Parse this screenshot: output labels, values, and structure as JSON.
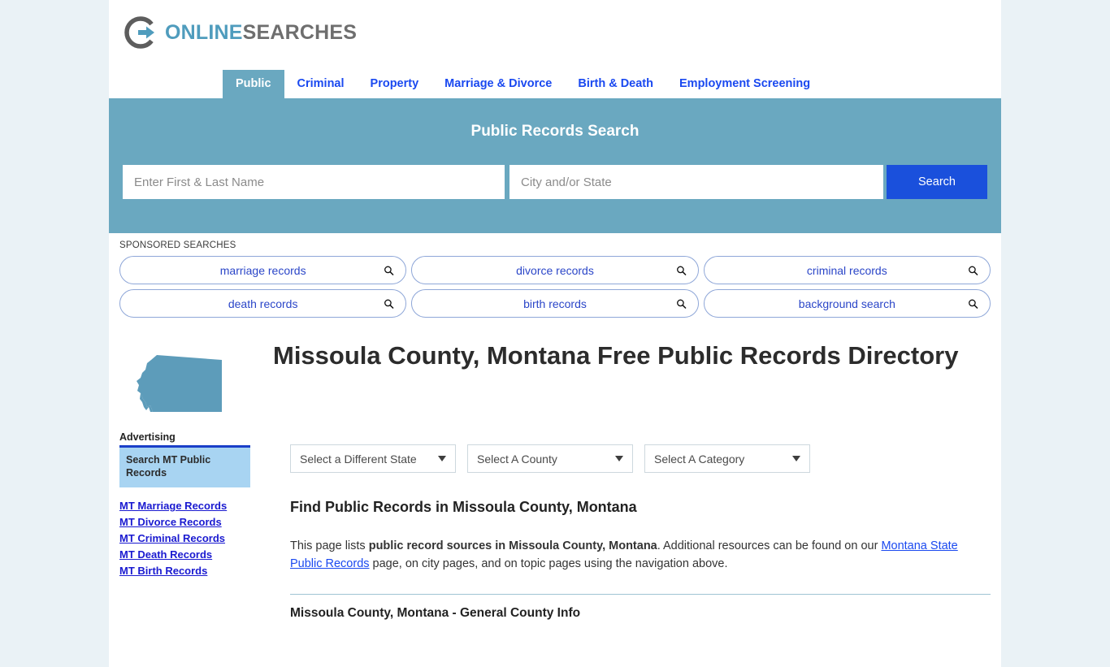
{
  "brand": {
    "name_part1": "ONLINE",
    "name_part2": "SEARCHES",
    "logo_icon": "circle-arrow-logo-icon",
    "accent_teal": "#6aa8c0",
    "accent_blue": "#1a50dc",
    "link_blue": "#1a49f0"
  },
  "nav": {
    "items": [
      {
        "label": "Public",
        "active": true
      },
      {
        "label": "Criminal",
        "active": false
      },
      {
        "label": "Property",
        "active": false
      },
      {
        "label": "Marriage & Divorce",
        "active": false
      },
      {
        "label": "Birth & Death",
        "active": false
      },
      {
        "label": "Employment Screening",
        "active": false
      }
    ]
  },
  "search_banner": {
    "title": "Public Records Search",
    "name_placeholder": "Enter First & Last Name",
    "name_value": "",
    "city_placeholder": "City and/or State",
    "city_value": "",
    "button_label": "Search"
  },
  "sponsored": {
    "label": "SPONSORED SEARCHES",
    "items": [
      {
        "label": "marriage records",
        "icon": "search-icon"
      },
      {
        "label": "divorce records",
        "icon": "search-icon"
      },
      {
        "label": "criminal records",
        "icon": "search-icon"
      },
      {
        "label": "death records",
        "icon": "search-icon"
      },
      {
        "label": "birth records",
        "icon": "search-icon"
      },
      {
        "label": "background search",
        "icon": "search-icon"
      }
    ]
  },
  "main": {
    "state_map_icon": "montana-state-map-icon",
    "page_title": "Missoula County, Montana Free Public Records Directory",
    "selects": {
      "state": "Select a Different State",
      "county": "Select A County",
      "category": "Select A Category"
    },
    "section_heading": "Find Public Records in Missoula County, Montana",
    "paragraph": {
      "text_1": "This page lists ",
      "bold_1": "public record sources in Missoula County, Montana",
      "text_2": ". Additional resources can be found on our ",
      "link_1": "Montana State Public Records",
      "text_3": " page, on city pages, and on topic pages using the navigation above."
    },
    "subheading": "Missoula County, Montana - General County Info"
  },
  "sidebar": {
    "advertising_label": "Advertising",
    "ad_box_title": "Search MT Public Records",
    "links": [
      {
        "label": "MT Marriage Records"
      },
      {
        "label": "MT Divorce Records"
      },
      {
        "label": "MT Criminal Records"
      },
      {
        "label": "MT Death Records"
      },
      {
        "label": "MT Birth Records"
      }
    ]
  }
}
